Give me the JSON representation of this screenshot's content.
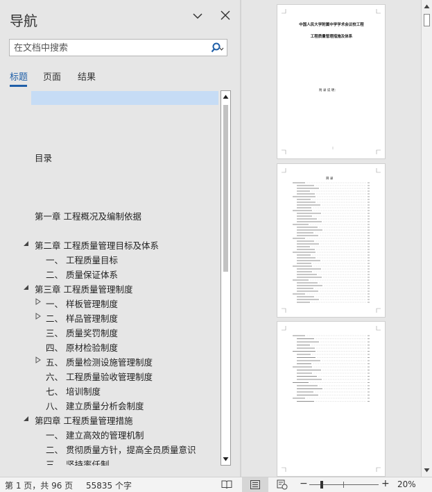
{
  "nav": {
    "title": "导航",
    "search_placeholder": "在文档中搜索",
    "tabs": [
      "标题",
      "页面",
      "结果"
    ]
  },
  "outline": [
    {
      "label": "",
      "indent": 0,
      "expander": "none"
    },
    {
      "label": "目录",
      "indent": 0,
      "expander": "none"
    },
    {
      "label": "第一章 工程概况及编制依据",
      "indent": 0,
      "expander": "none"
    },
    {
      "label": "第二章 工程质量管理目标及体系",
      "indent": 0,
      "expander": "expanded"
    },
    {
      "label": "一、 工程质量目标",
      "indent": 1,
      "expander": "none"
    },
    {
      "label": "二、 质量保证体系",
      "indent": 1,
      "expander": "none"
    },
    {
      "label": "第三章 工程质量管理制度",
      "indent": 0,
      "expander": "expanded"
    },
    {
      "label": "一、 样板管理制度",
      "indent": 1,
      "expander": "collapsed"
    },
    {
      "label": "二、 样品管理制度",
      "indent": 1,
      "expander": "collapsed"
    },
    {
      "label": "三、 质量奖罚制度",
      "indent": 1,
      "expander": "none"
    },
    {
      "label": "四、 原材检验制度",
      "indent": 1,
      "expander": "none"
    },
    {
      "label": "五、 质量检测设施管理制度",
      "indent": 1,
      "expander": "collapsed"
    },
    {
      "label": "六、 工程质量验收管理制度",
      "indent": 1,
      "expander": "none"
    },
    {
      "label": "七、 培训制度",
      "indent": 1,
      "expander": "none"
    },
    {
      "label": "八、 建立质量分析会制度",
      "indent": 1,
      "expander": "none"
    },
    {
      "label": "第四章 工程质量管理措施",
      "indent": 0,
      "expander": "expanded"
    },
    {
      "label": "一、 建立高效的管理机制",
      "indent": 1,
      "expander": "none"
    },
    {
      "label": "二、 贯彻质量方针，提高全员质量意识",
      "indent": 1,
      "expander": "none"
    },
    {
      "label": "三、 坚持率仟制",
      "indent": 1,
      "expander": "none"
    }
  ],
  "thumbnails": {
    "page1": {
      "title_line1": "中国人民大学附属中学学术会议校工程",
      "title_line2": "工程质量管理措施及体系",
      "footer_text": "附 录 说 明："
    },
    "page2": {
      "heading": "目 录"
    }
  },
  "status": {
    "page_info": "第 1 页，共 96 页",
    "word_count": "55835 个字",
    "zoom": "20%",
    "zoom_level": 0.2
  },
  "colors": {
    "accent": "#1f5fa8",
    "highlight": "#c6dcf5"
  }
}
